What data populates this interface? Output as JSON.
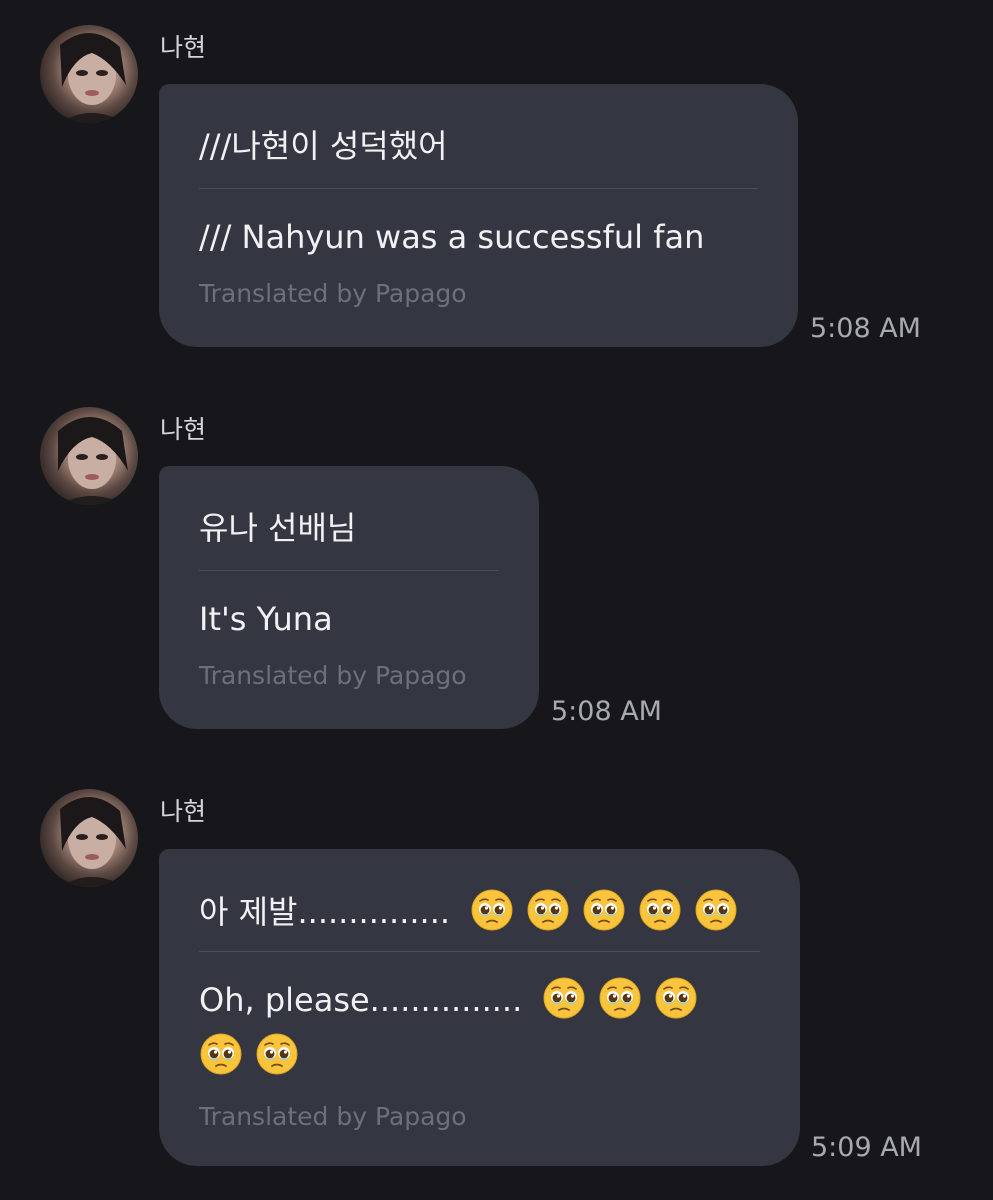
{
  "messages": [
    {
      "sender": "나현",
      "original": "///나현이 성덕했어",
      "translation": "/// Nahyun was a successful fan",
      "credit": "Translated by Papago",
      "time": "5:08 AM"
    },
    {
      "sender": "나현",
      "original": "유나 선배님",
      "translation": "It's Yuna",
      "credit": "Translated by Papago",
      "time": "5:08 AM"
    },
    {
      "sender": "나현",
      "original": "아 제발...............",
      "original_emoji_count": 5,
      "translation": "Oh, please...............",
      "translation_emoji_count_line1": 3,
      "translation_emoji_count_line2": 2,
      "emoji": "pleading-face-emoji",
      "credit": "Translated by Papago",
      "time": "5:09 AM"
    }
  ],
  "colors": {
    "background": "#17171b",
    "bubble": "#343641",
    "timestamp": "#a8a9b1",
    "credit": "#6d6f7b"
  }
}
